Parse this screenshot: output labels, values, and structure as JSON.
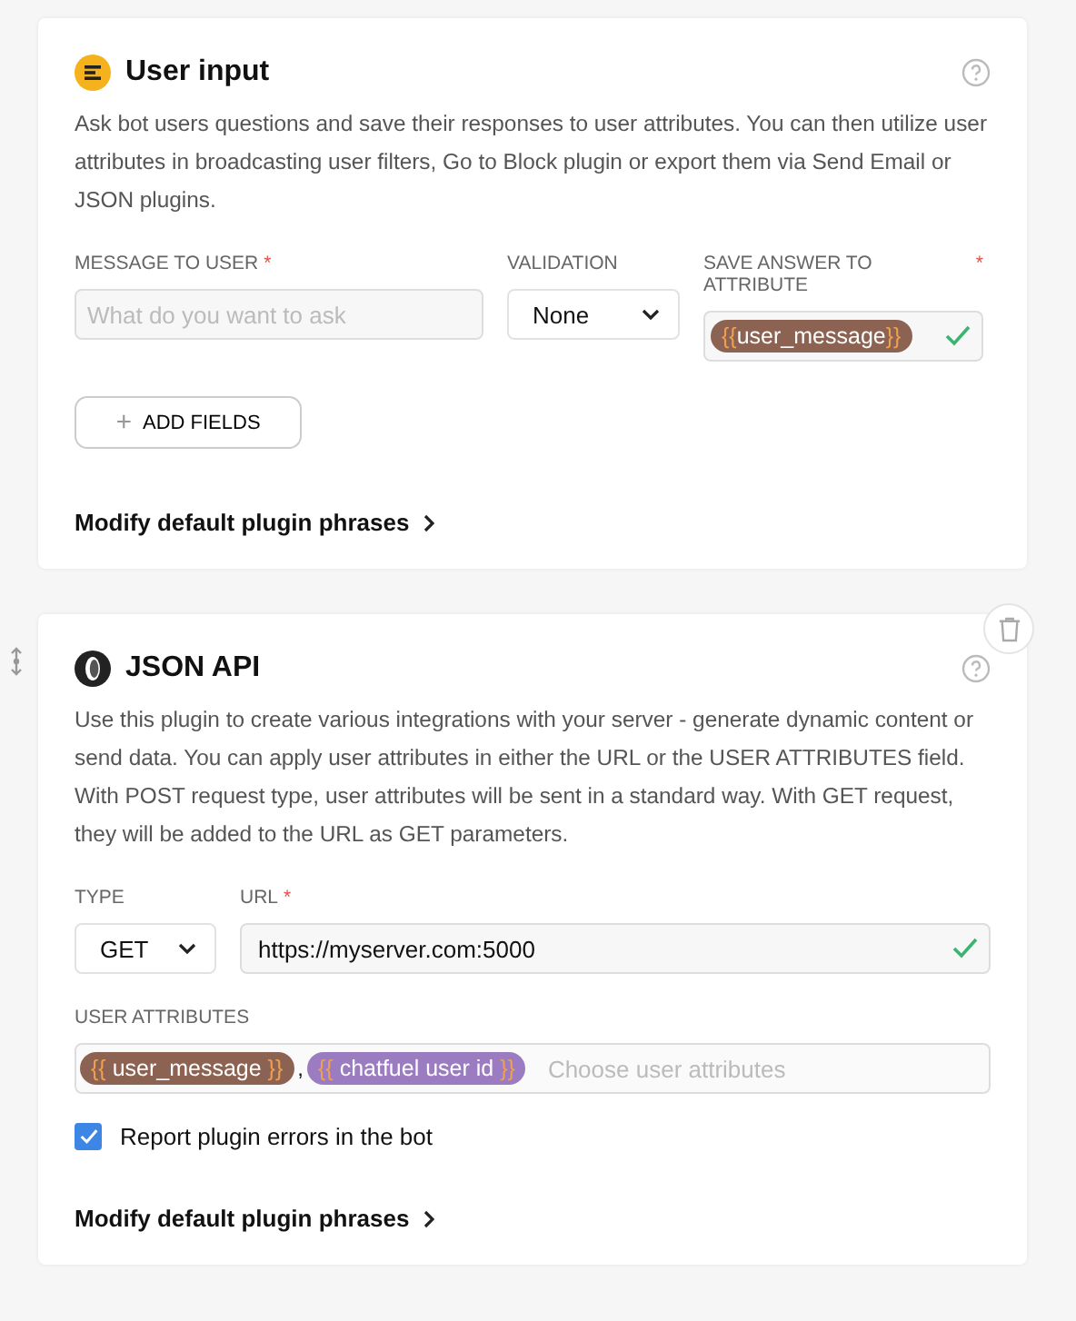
{
  "cards": [
    {
      "kind": "user_input",
      "title": "User input",
      "description": "Ask bot users questions and save their responses to user attributes. You can then utilize user attributes in broadcasting user filters, Go to Block plugin or export them via Send Email or JSON plugins.",
      "fields": {
        "message": {
          "label": "MESSAGE TO USER",
          "required_mark": "*",
          "placeholder": "What do you want to ask"
        },
        "validation": {
          "label": "VALIDATION",
          "value": "None"
        },
        "save": {
          "label": "SAVE ANSWER TO ATTRIBUTE",
          "required_mark": "*",
          "chip": {
            "open": "{{",
            "name": "user_message",
            "close": "}}",
            "color": "#8c6352"
          },
          "valid": true
        }
      },
      "add_button": {
        "icon": "+",
        "label": "ADD FIELDS"
      },
      "modify_link": "Modify default plugin phrases"
    },
    {
      "kind": "json_api",
      "title": "JSON API",
      "description": "Use this plugin to create various integrations with your server - generate dynamic content or send data. You can apply user attributes in either the URL or the USER ATTRIBUTES field. With POST request type, user attributes will be sent in a standard way. With GET request, they will be added to the URL as GET parameters.",
      "fields": {
        "type": {
          "label": "TYPE",
          "value": "GET"
        },
        "url": {
          "label": "URL",
          "required_mark": "*",
          "value": "https://myserver.com:5000",
          "valid": true
        },
        "attributes": {
          "label": "USER ATTRIBUTES",
          "separator": ",",
          "chips": [
            {
              "open": "{{",
              "name": "user_message",
              "close": "}}",
              "color": "#8c6352"
            },
            {
              "open": "{{",
              "name": "chatfuel user id",
              "close": "}}",
              "color": "#9b7cc0"
            }
          ],
          "placeholder": "Choose user attributes"
        }
      },
      "report_errors": {
        "label": "Report plugin errors in the bot",
        "checked": true
      },
      "modify_link": "Modify default plugin phrases"
    }
  ]
}
